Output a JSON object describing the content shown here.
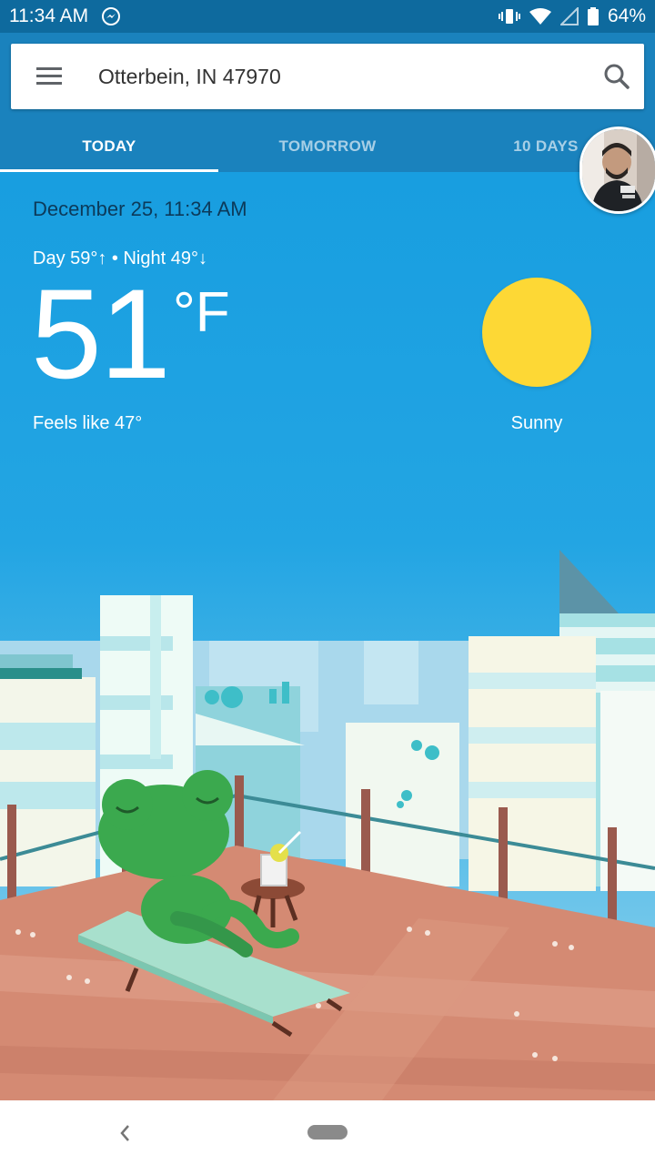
{
  "status_bar": {
    "time": "11:34 AM",
    "battery": "64%",
    "icons": [
      "messenger-icon",
      "vibrate-icon",
      "wifi-icon",
      "signal-icon",
      "battery-icon"
    ]
  },
  "search": {
    "location": "Otterbein, IN 47970"
  },
  "tabs": [
    {
      "label": "TODAY",
      "active": true
    },
    {
      "label": "TOMORROW",
      "active": false
    },
    {
      "label": "10 DAYS",
      "active": false
    }
  ],
  "weather": {
    "date": "December 25, 11:34 AM",
    "day_night": "Day 59°↑ • Night 49°↓",
    "temperature": "51",
    "unit": "°F",
    "feels_like": "Feels like 47°",
    "condition": "Sunny"
  },
  "colors": {
    "status_bar": "#0e6a9e",
    "header": "#1a82bd",
    "sky": "#189ee0",
    "sun": "#fdd835"
  }
}
